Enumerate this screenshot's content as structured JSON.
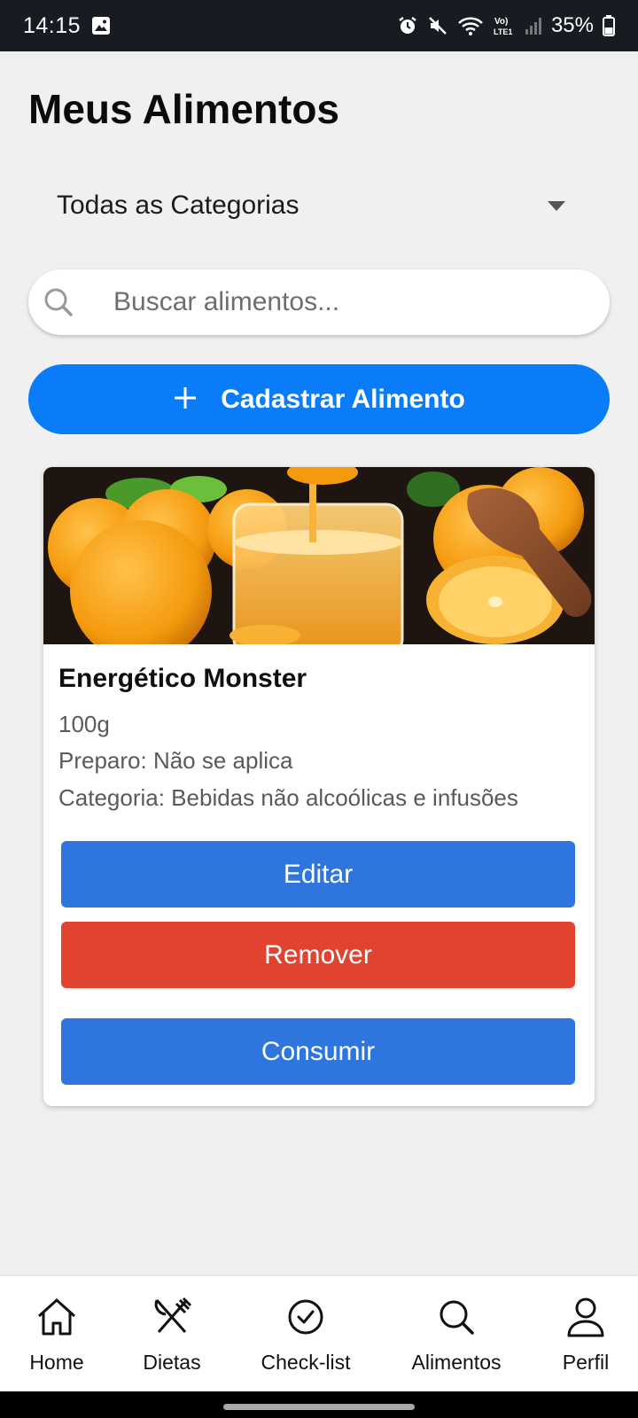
{
  "status_bar": {
    "time": "14:15",
    "battery": "35%"
  },
  "page": {
    "title": "Meus Alimentos"
  },
  "filter": {
    "category_selected": "Todas as Categorias"
  },
  "search": {
    "placeholder": "Buscar alimentos..."
  },
  "actions": {
    "add_food_label": "Cadastrar Alimento"
  },
  "food_card": {
    "name": "Energético Monster",
    "portion": "100g",
    "prep": "Preparo: Não se aplica",
    "category": "Categoria: Bebidas não alcoólicas e infusões",
    "edit_label": "Editar",
    "remove_label": "Remover",
    "consume_label": "Consumir",
    "image": "orange-juice-photo"
  },
  "bottom_nav": {
    "items": [
      {
        "label": "Home",
        "icon": "home-icon"
      },
      {
        "label": "Dietas",
        "icon": "utensils-icon"
      },
      {
        "label": "Check-list",
        "icon": "check-circle-icon"
      },
      {
        "label": "Alimentos",
        "icon": "search-icon"
      },
      {
        "label": "Perfil",
        "icon": "user-icon"
      }
    ]
  },
  "colors": {
    "primary": "#0a7cf8",
    "edit": "#2e75de",
    "remove": "#e14331",
    "background": "#f0f0f0"
  }
}
